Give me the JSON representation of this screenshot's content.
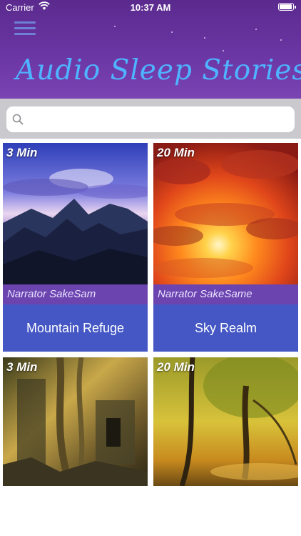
{
  "status_bar": {
    "carrier": "Carrier",
    "time": "10:37 AM"
  },
  "header": {
    "title": "Audio Sleep Stories",
    "menu_icon": "hamburger-menu-icon"
  },
  "search": {
    "placeholder": "",
    "value": "",
    "icon": "search-icon"
  },
  "cards": [
    {
      "duration": "3 Min",
      "narrator": "Narrator  SakeSam",
      "title": "Mountain Refuge"
    },
    {
      "duration": "20 Min",
      "narrator": "Narrator  SakeSame",
      "title": "Sky Realm"
    },
    {
      "duration": "3 Min"
    },
    {
      "duration": "20 Min"
    }
  ],
  "colors": {
    "header": "#6a36a3",
    "title": "#4fb3ff",
    "narrator_bar": "#6c44b0",
    "title_bar": "#4457c4",
    "search_bar_bg": "#c9c9ce"
  }
}
